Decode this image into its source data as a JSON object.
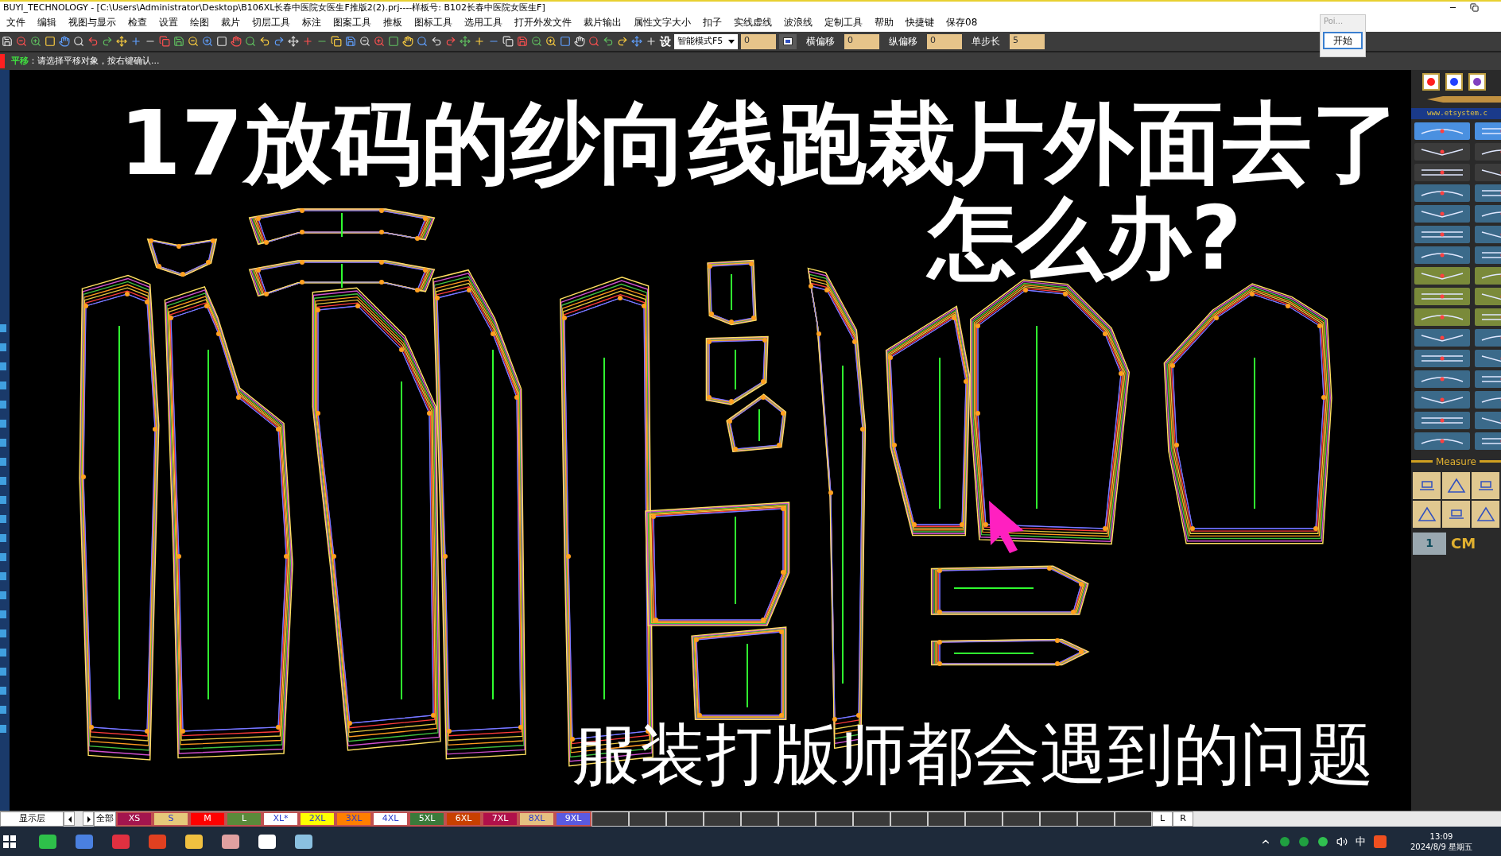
{
  "window": {
    "title": "BUYI_TECHNOLOGY - [C:\\Users\\Administrator\\Desktop\\B106XL长春中医院女医生F推版2(2).prj----样板号: B102长春中医院女医生F]"
  },
  "menu": [
    "文件",
    "编辑",
    "视图与显示",
    "检查",
    "设置",
    "绘图",
    "裁片",
    "切层工具",
    "标注",
    "图案工具",
    "推板",
    "图标工具",
    "选用工具",
    "打开外发文件",
    "裁片输出",
    "属性文字大小",
    "扣子",
    "实线虚线",
    "波浪线",
    "定制工具",
    "帮助",
    "快捷键",
    "保存08"
  ],
  "toolbar": {
    "settings_glyph": "设",
    "mode_dropdown": "智能模式F5",
    "value_field": "0",
    "fields": [
      {
        "label": "横偏移",
        "value": "0"
      },
      {
        "label": "纵偏移",
        "value": "0"
      },
      {
        "label": "单步长",
        "value": "5"
      }
    ]
  },
  "popup": {
    "title": "Poi...",
    "button": "开始"
  },
  "status_bar": {
    "command": "平移",
    "prompt": "：请选择平移对象，按右键确认..."
  },
  "overlay": {
    "headline": "17放码的纱向线跑裁片外面去了",
    "question": "怎么办?",
    "caption": "服装打版师都会遇到的问题"
  },
  "right_panel": {
    "url": "www.etsystem.c",
    "section": "Measure",
    "page": "1",
    "unit": "CM"
  },
  "layer_bar": {
    "label": "显示层",
    "all": "全部",
    "sizes": [
      {
        "label": "XS",
        "color": "#a3154e"
      },
      {
        "label": "S",
        "color": "#e6c87a"
      },
      {
        "label": "M",
        "color": "#ff0000"
      },
      {
        "label": "L",
        "color": "#5a8a3a"
      },
      {
        "label": "XL*",
        "color": "#ffffff"
      },
      {
        "label": "2XL",
        "color": "#ffff00"
      },
      {
        "label": "3XL",
        "color": "#ff7f00"
      },
      {
        "label": "4XL",
        "color": "#ffffff"
      },
      {
        "label": "5XL",
        "color": "#3a7a3a"
      },
      {
        "label": "6XL",
        "color": "#c84000"
      },
      {
        "label": "7XL",
        "color": "#b0104a"
      },
      {
        "label": "8XL",
        "color": "#e6c080"
      },
      {
        "label": "9XL",
        "color": "#5a5ae0"
      }
    ],
    "sides": [
      "L",
      "R"
    ]
  },
  "taskbar": {
    "ime": "中",
    "time": "13:09",
    "date": "2024/8/9 星期五"
  }
}
